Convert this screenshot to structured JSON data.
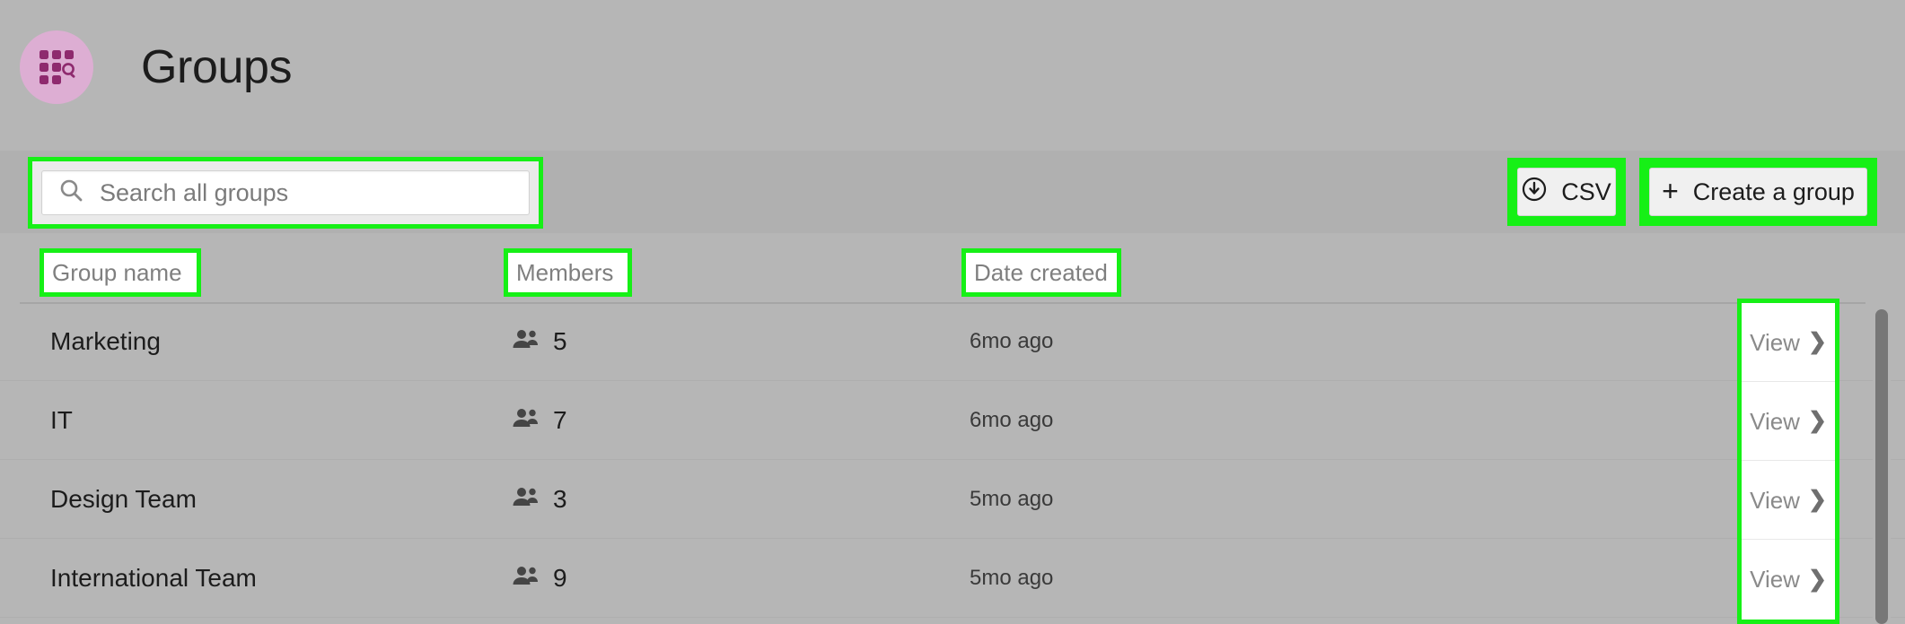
{
  "header": {
    "title": "Groups",
    "icon": "groups-grid-search-icon",
    "icon_bg": "#ddaed3",
    "icon_fg": "#8e2a6e"
  },
  "toolbar": {
    "search": {
      "placeholder": "Search all groups",
      "value": "",
      "icon": "search-icon"
    },
    "csv_button": {
      "label": "CSV",
      "icon": "download-circle-icon"
    },
    "create_button": {
      "label": "Create a group",
      "icon": "plus-icon"
    }
  },
  "table": {
    "columns": [
      {
        "key": "name",
        "label": "Group name"
      },
      {
        "key": "members",
        "label": "Members"
      },
      {
        "key": "date",
        "label": "Date created"
      },
      {
        "key": "action",
        "label": ""
      }
    ],
    "rows": [
      {
        "name": "Marketing",
        "members": "5",
        "date": "6mo ago",
        "action": "View"
      },
      {
        "name": "IT",
        "members": "7",
        "date": "6mo ago",
        "action": "View"
      },
      {
        "name": "Design Team",
        "members": "3",
        "date": "5mo ago",
        "action": "View"
      },
      {
        "name": "International Team",
        "members": "9",
        "date": "5mo ago",
        "action": "View"
      }
    ],
    "member_icon": "people-icon",
    "chevron": "❯"
  },
  "annotation": {
    "highlight_color": "#16f016"
  }
}
